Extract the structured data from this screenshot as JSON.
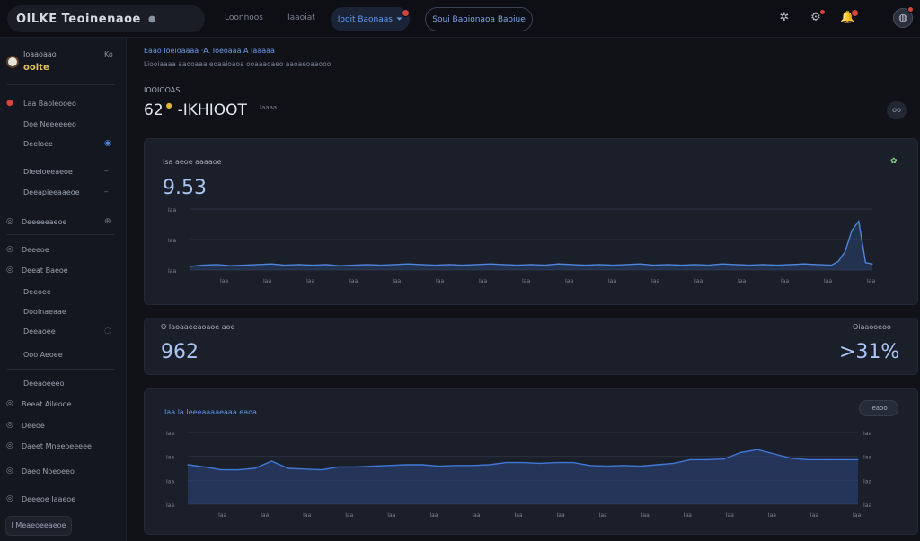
{
  "topbar": {
    "brand": "OILKE Teoinenaoe",
    "brand_menu_icon": "ellipsis-icon",
    "nav": [
      "Loonnoos",
      "Iaaoiat"
    ],
    "active_tab": "Iooit Baonaas",
    "outline_button": "Soui Baoionaoa Baoiue",
    "icons": [
      "settings-icon",
      "gear-icon",
      "bell-icon",
      "avatar"
    ]
  },
  "sidebar": {
    "account_name": "Ioaaoaao",
    "account_sub": "oolte",
    "account_end": "Ko",
    "items": [
      {
        "label": "Laa Baoleooeo",
        "icon": "dot-icon"
      },
      {
        "label": "Doe Neeeeeeo",
        "icon": ""
      },
      {
        "label": "Deeloee",
        "icon": "",
        "tail": "◉"
      },
      {
        "label": "Dleeloeeaeoe",
        "icon": "",
        "tail": "–"
      },
      {
        "label": "Deeapieeaaeoe",
        "icon": "",
        "tail": "–"
      },
      {
        "label": "Deeeeeaeoe",
        "icon": "circle-icon",
        "tail": "⊕"
      },
      {
        "label": "Deeeoe",
        "icon": "circle-icon"
      },
      {
        "label": "Deeat Baeoe",
        "icon": "circle-icon"
      },
      {
        "label": "Deeoee",
        "icon": ""
      },
      {
        "label": "Dooinaeaae",
        "icon": ""
      },
      {
        "label": "Deeaoee",
        "icon": "",
        "tail": "◌"
      },
      {
        "label": "Ooo Aeoee",
        "icon": ""
      },
      {
        "label": "Deeaoeeeo",
        "icon": ""
      },
      {
        "label": "Beeat Aileooe",
        "icon": "circle-icon"
      },
      {
        "label": "Deeoe",
        "icon": "circle-icon"
      },
      {
        "label": "Daeet Mneeoeeeee",
        "icon": "circle-icon"
      },
      {
        "label": "Daeo Noeoeeo",
        "icon": "circle-icon"
      },
      {
        "label": "Deeeoe Iaaeoe",
        "icon": "circle-icon"
      }
    ],
    "bottom_button": "I Meaeoeeaeoe"
  },
  "main": {
    "breadcrumb": "Eaao Ioeioaaaa  ·A. Ioeoaaa A Iaaaaa",
    "breadcrumb_sub": "Liooiaaaa aaooaaa eoaaioaoa ooaaaoaeo aaoaeoaaooo",
    "stat_label": "IOOIOOAS",
    "stat_value": "62",
    "stat_suffix": "-IKHIOOT",
    "stat_unit": "Iaaaa",
    "round_button": "oo"
  },
  "card1": {
    "title": "Isa aeoe aaaaoe",
    "value": "9.53",
    "corner_icon": "status-icon"
  },
  "card2": {
    "title": "O Iaoaaeeaoaoe aoe",
    "value": "962",
    "right_title": "Oiaaooeoo",
    "right_value": ">31%"
  },
  "card3": {
    "title": "Iaa la Ieeeaaaaeaaa eaoa",
    "chip": "Ieaoo"
  },
  "chart_data": [
    {
      "type": "line",
      "title": "Isa aeoe aaaaoe",
      "y_ticks": [
        "Iaa",
        "Iaa",
        "Iaa"
      ],
      "x_ticks": [
        "Iaa",
        "Iaa",
        "Iaa",
        "Iaa",
        "Iaa",
        "Iaa",
        "Iaa",
        "Iaa",
        "Iaa",
        "Iaa",
        "Iaa",
        "Iaa",
        "Iaa",
        "Iaa",
        "Iaa",
        "Iaa"
      ],
      "ylim": [
        0,
        100
      ],
      "x": [
        0,
        4,
        8,
        12,
        16,
        20,
        24,
        28,
        32,
        36,
        40,
        44,
        48,
        52,
        56,
        60,
        64,
        68,
        72,
        76,
        80,
        84,
        88,
        92,
        96,
        100,
        104,
        108,
        112,
        116,
        120,
        124,
        128,
        132,
        136,
        140,
        144,
        148,
        152,
        156,
        160,
        164,
        168,
        172,
        176,
        180,
        184,
        188,
        190,
        192,
        194,
        196,
        198,
        200
      ],
      "values": [
        6,
        8,
        9,
        7,
        8,
        9,
        10,
        8,
        9,
        8,
        9,
        7,
        8,
        9,
        8,
        9,
        10,
        9,
        8,
        9,
        8,
        9,
        10,
        9,
        8,
        9,
        8,
        10,
        9,
        8,
        9,
        8,
        9,
        10,
        8,
        9,
        8,
        9,
        8,
        10,
        9,
        8,
        9,
        8,
        9,
        10,
        9,
        8,
        14,
        30,
        65,
        80,
        12,
        10
      ],
      "grid": true
    },
    {
      "type": "area",
      "title": "Iaa la Ieeeaaaaeaaa eaoa",
      "y_ticks_left": [
        "Iaa",
        "Iaa",
        "Iaa",
        "Iaa"
      ],
      "y_ticks_right": [
        "Iaa",
        "Iaa",
        "Iaa",
        "Iaa"
      ],
      "x_ticks": [
        "Iaa",
        "Iaa",
        "Iaa",
        "Iaa",
        "Iaa",
        "Iaa",
        "Iaa",
        "Iaa",
        "Iaa",
        "Iaa",
        "Iaa",
        "Iaa",
        "Iaa",
        "Iaa",
        "Iaa",
        "Iaa"
      ],
      "ylim": [
        0,
        100
      ],
      "x": [
        0,
        5,
        10,
        15,
        20,
        25,
        30,
        35,
        40,
        45,
        50,
        55,
        60,
        65,
        70,
        75,
        80,
        85,
        90,
        95,
        100,
        105,
        110,
        115,
        120,
        125,
        130,
        135,
        140,
        145,
        150,
        155,
        160,
        165,
        170,
        175,
        180,
        185,
        190,
        195,
        200
      ],
      "values": [
        55,
        52,
        48,
        48,
        50,
        60,
        50,
        49,
        48,
        52,
        52,
        53,
        54,
        55,
        55,
        53,
        54,
        54,
        55,
        58,
        58,
        57,
        58,
        58,
        54,
        53,
        54,
        53,
        55,
        57,
        62,
        62,
        63,
        72,
        76,
        70,
        64,
        62,
        62,
        62,
        62
      ],
      "grid": true
    }
  ]
}
